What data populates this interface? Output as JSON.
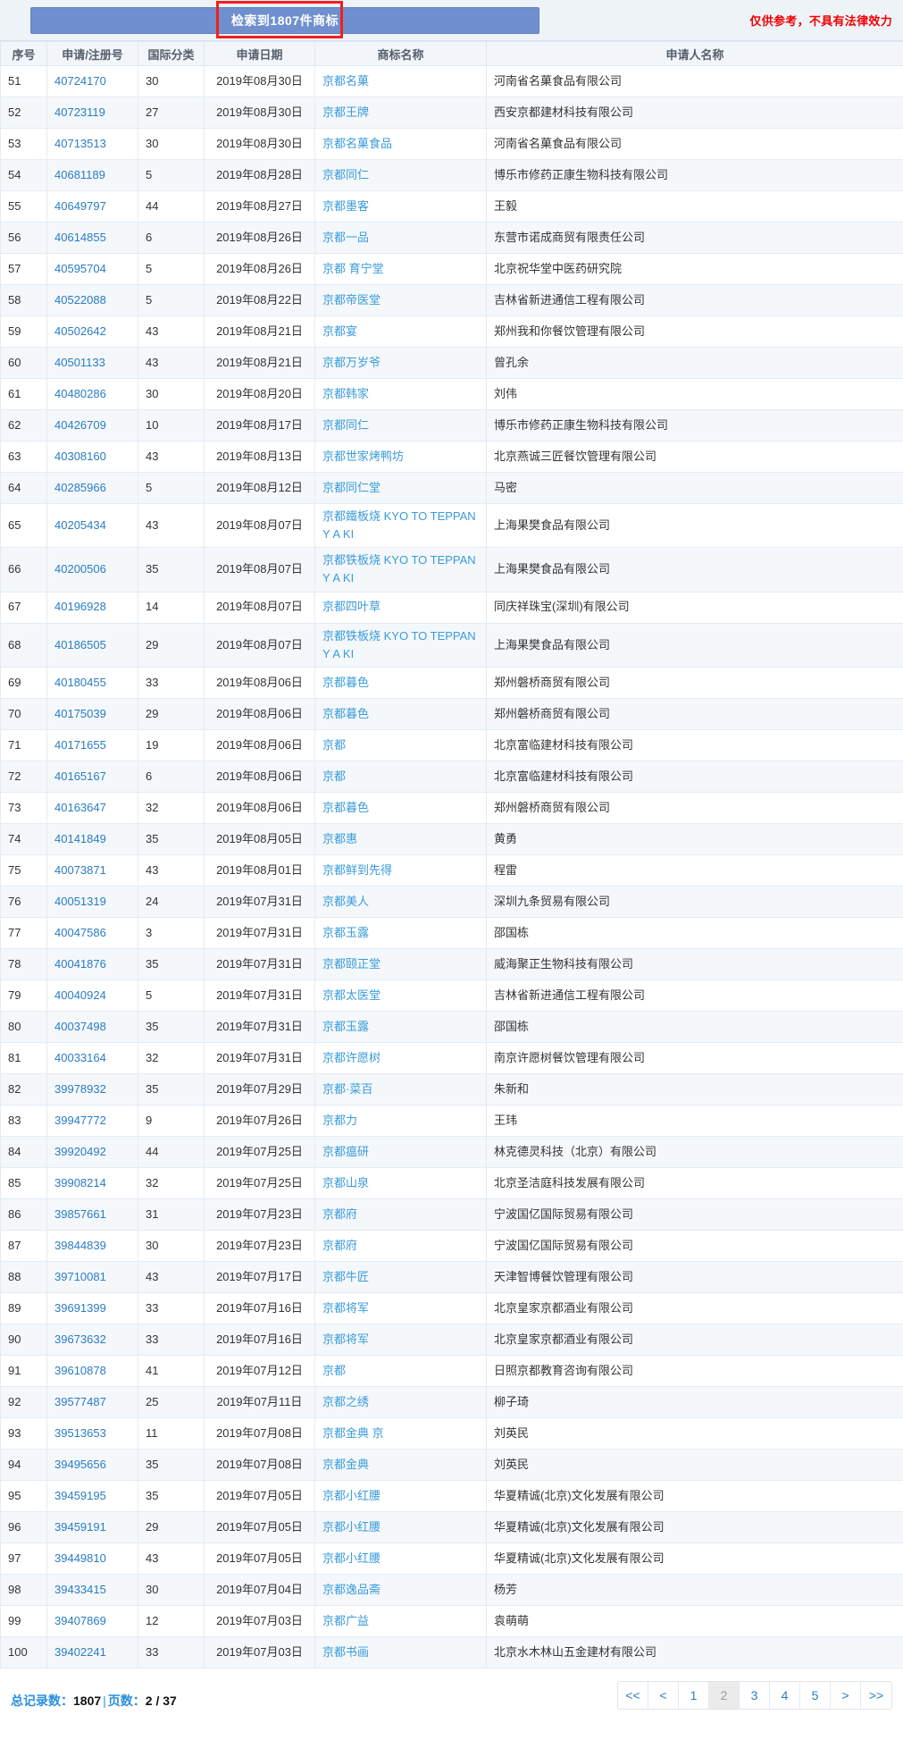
{
  "banner": {
    "result_text": "检索到1807件商标",
    "legal_note": "仅供参考，不具有法律效力",
    "accent_color": "#6f8fce",
    "highlight_color": "#f21f1f",
    "note_color": "#f00000"
  },
  "table": {
    "columns": [
      "序号",
      "申请/注册号",
      "国际分类",
      "申请日期",
      "商标名称",
      "申请人名称"
    ],
    "rows": [
      {
        "seq": "51",
        "regno": "40724170",
        "cls": "30",
        "date": "2019年08月30日",
        "mark": "京都名菓",
        "appl": "河南省名菓食品有限公司"
      },
      {
        "seq": "52",
        "regno": "40723119",
        "cls": "27",
        "date": "2019年08月30日",
        "mark": "京都王牌",
        "appl": "西安京都建材科技有限公司"
      },
      {
        "seq": "53",
        "regno": "40713513",
        "cls": "30",
        "date": "2019年08月30日",
        "mark": "京都名菓食品",
        "appl": "河南省名菓食品有限公司"
      },
      {
        "seq": "54",
        "regno": "40681189",
        "cls": "5",
        "date": "2019年08月28日",
        "mark": "京都同仁",
        "appl": "博乐市修药正康生物科技有限公司"
      },
      {
        "seq": "55",
        "regno": "40649797",
        "cls": "44",
        "date": "2019年08月27日",
        "mark": "京都墨客",
        "appl": "王毅"
      },
      {
        "seq": "56",
        "regno": "40614855",
        "cls": "6",
        "date": "2019年08月26日",
        "mark": "京都一品",
        "appl": "东营市诺成商贸有限责任公司"
      },
      {
        "seq": "57",
        "regno": "40595704",
        "cls": "5",
        "date": "2019年08月26日",
        "mark": "京都 育宁堂",
        "appl": "北京祝华堂中医药研究院"
      },
      {
        "seq": "58",
        "regno": "40522088",
        "cls": "5",
        "date": "2019年08月22日",
        "mark": "京都帝医堂",
        "appl": "吉林省新进通信工程有限公司"
      },
      {
        "seq": "59",
        "regno": "40502642",
        "cls": "43",
        "date": "2019年08月21日",
        "mark": "京都宴",
        "appl": "郑州我和你餐饮管理有限公司"
      },
      {
        "seq": "60",
        "regno": "40501133",
        "cls": "43",
        "date": "2019年08月21日",
        "mark": "京都万岁爷",
        "appl": "曾孔余"
      },
      {
        "seq": "61",
        "regno": "40480286",
        "cls": "30",
        "date": "2019年08月20日",
        "mark": "京都韩家",
        "appl": "刘伟"
      },
      {
        "seq": "62",
        "regno": "40426709",
        "cls": "10",
        "date": "2019年08月17日",
        "mark": "京都同仁",
        "appl": "博乐市修药正康生物科技有限公司"
      },
      {
        "seq": "63",
        "regno": "40308160",
        "cls": "43",
        "date": "2019年08月13日",
        "mark": "京都世家烤鸭坊",
        "appl": "北京燕诚三匠餐饮管理有限公司"
      },
      {
        "seq": "64",
        "regno": "40285966",
        "cls": "5",
        "date": "2019年08月12日",
        "mark": "京都同仁堂",
        "appl": "马密"
      },
      {
        "seq": "65",
        "regno": "40205434",
        "cls": "43",
        "date": "2019年08月07日",
        "mark": "京都鐵板烧 KYO TO TEPPAN Y A KI",
        "appl": "上海果樊食品有限公司"
      },
      {
        "seq": "66",
        "regno": "40200506",
        "cls": "35",
        "date": "2019年08月07日",
        "mark": "京都铁板烧 KYO TO TEPPAN Y A KI",
        "appl": "上海果樊食品有限公司"
      },
      {
        "seq": "67",
        "regno": "40196928",
        "cls": "14",
        "date": "2019年08月07日",
        "mark": "京都四叶草",
        "appl": "同庆祥珠宝(深圳)有限公司"
      },
      {
        "seq": "68",
        "regno": "40186505",
        "cls": "29",
        "date": "2019年08月07日",
        "mark": "京都铁板烧 KYO TO TEPPAN Y A KI",
        "appl": "上海果樊食品有限公司"
      },
      {
        "seq": "69",
        "regno": "40180455",
        "cls": "33",
        "date": "2019年08月06日",
        "mark": "京都暮色",
        "appl": "郑州磐桥商贸有限公司"
      },
      {
        "seq": "70",
        "regno": "40175039",
        "cls": "29",
        "date": "2019年08月06日",
        "mark": "京都暮色",
        "appl": "郑州磐桥商贸有限公司"
      },
      {
        "seq": "71",
        "regno": "40171655",
        "cls": "19",
        "date": "2019年08月06日",
        "mark": "京都",
        "appl": "北京富临建材科技有限公司"
      },
      {
        "seq": "72",
        "regno": "40165167",
        "cls": "6",
        "date": "2019年08月06日",
        "mark": "京都",
        "appl": "北京富临建材科技有限公司"
      },
      {
        "seq": "73",
        "regno": "40163647",
        "cls": "32",
        "date": "2019年08月06日",
        "mark": "京都暮色",
        "appl": "郑州磐桥商贸有限公司"
      },
      {
        "seq": "74",
        "regno": "40141849",
        "cls": "35",
        "date": "2019年08月05日",
        "mark": "京都惠",
        "appl": "黄勇"
      },
      {
        "seq": "75",
        "regno": "40073871",
        "cls": "43",
        "date": "2019年08月01日",
        "mark": "京都鲜到先得",
        "appl": "程雷"
      },
      {
        "seq": "76",
        "regno": "40051319",
        "cls": "24",
        "date": "2019年07月31日",
        "mark": "京都美人",
        "appl": "深圳九条贸易有限公司"
      },
      {
        "seq": "77",
        "regno": "40047586",
        "cls": "3",
        "date": "2019年07月31日",
        "mark": "京都玉露",
        "appl": "邵国栋"
      },
      {
        "seq": "78",
        "regno": "40041876",
        "cls": "35",
        "date": "2019年07月31日",
        "mark": "京都颐正堂",
        "appl": "威海聚正生物科技有限公司"
      },
      {
        "seq": "79",
        "regno": "40040924",
        "cls": "5",
        "date": "2019年07月31日",
        "mark": "京都太医堂",
        "appl": "吉林省新进通信工程有限公司"
      },
      {
        "seq": "80",
        "regno": "40037498",
        "cls": "35",
        "date": "2019年07月31日",
        "mark": "京都玉露",
        "appl": "邵国栋"
      },
      {
        "seq": "81",
        "regno": "40033164",
        "cls": "32",
        "date": "2019年07月31日",
        "mark": "京都许愿树",
        "appl": "南京许愿树餐饮管理有限公司"
      },
      {
        "seq": "82",
        "regno": "39978932",
        "cls": "35",
        "date": "2019年07月29日",
        "mark": "京都·菜百",
        "appl": "朱新和"
      },
      {
        "seq": "83",
        "regno": "39947772",
        "cls": "9",
        "date": "2019年07月26日",
        "mark": "京都力",
        "appl": "王玮"
      },
      {
        "seq": "84",
        "regno": "39920492",
        "cls": "44",
        "date": "2019年07月25日",
        "mark": "京都瘟研",
        "appl": "林克德灵科技（北京）有限公司"
      },
      {
        "seq": "85",
        "regno": "39908214",
        "cls": "32",
        "date": "2019年07月25日",
        "mark": "京都山泉",
        "appl": "北京圣洁庭科技发展有限公司"
      },
      {
        "seq": "86",
        "regno": "39857661",
        "cls": "31",
        "date": "2019年07月23日",
        "mark": "京都府",
        "appl": "宁波国亿国际贸易有限公司"
      },
      {
        "seq": "87",
        "regno": "39844839",
        "cls": "30",
        "date": "2019年07月23日",
        "mark": "京都府",
        "appl": "宁波国亿国际贸易有限公司"
      },
      {
        "seq": "88",
        "regno": "39710081",
        "cls": "43",
        "date": "2019年07月17日",
        "mark": "京都牛匠",
        "appl": "天津智博餐饮管理有限公司"
      },
      {
        "seq": "89",
        "regno": "39691399",
        "cls": "33",
        "date": "2019年07月16日",
        "mark": "京都将军",
        "appl": "北京皇家京都酒业有限公司"
      },
      {
        "seq": "90",
        "regno": "39673632",
        "cls": "33",
        "date": "2019年07月16日",
        "mark": "京都将军",
        "appl": "北京皇家京都酒业有限公司"
      },
      {
        "seq": "91",
        "regno": "39610878",
        "cls": "41",
        "date": "2019年07月12日",
        "mark": "京都",
        "appl": "日照京都教育咨询有限公司"
      },
      {
        "seq": "92",
        "regno": "39577487",
        "cls": "25",
        "date": "2019年07月11日",
        "mark": "京都之绣",
        "appl": "柳子琦"
      },
      {
        "seq": "93",
        "regno": "39513653",
        "cls": "11",
        "date": "2019年07月08日",
        "mark": "京都金典 京",
        "appl": "刘英民"
      },
      {
        "seq": "94",
        "regno": "39495656",
        "cls": "35",
        "date": "2019年07月08日",
        "mark": "京都金典",
        "appl": "刘英民"
      },
      {
        "seq": "95",
        "regno": "39459195",
        "cls": "35",
        "date": "2019年07月05日",
        "mark": "京都小红腰",
        "appl": "华夏精诚(北京)文化发展有限公司"
      },
      {
        "seq": "96",
        "regno": "39459191",
        "cls": "29",
        "date": "2019年07月05日",
        "mark": "京都小红腰",
        "appl": "华夏精诚(北京)文化发展有限公司"
      },
      {
        "seq": "97",
        "regno": "39449810",
        "cls": "43",
        "date": "2019年07月05日",
        "mark": "京都小红腰",
        "appl": "华夏精诚(北京)文化发展有限公司"
      },
      {
        "seq": "98",
        "regno": "39433415",
        "cls": "30",
        "date": "2019年07月04日",
        "mark": "京都逸品斋",
        "appl": "杨芳"
      },
      {
        "seq": "99",
        "regno": "39407869",
        "cls": "12",
        "date": "2019年07月03日",
        "mark": "京都广益",
        "appl": "袁萌萌"
      },
      {
        "seq": "100",
        "regno": "39402241",
        "cls": "33",
        "date": "2019年07月03日",
        "mark": "京都书画",
        "appl": "北京水木林山五金建材有限公司"
      }
    ]
  },
  "footer": {
    "total_label": "总记录数：",
    "total_value": "1807",
    "separator": "|",
    "page_label": "页数：",
    "page_value": "2 / 37",
    "pagination": [
      {
        "label": "<<",
        "name": "first-page",
        "active": false
      },
      {
        "label": "<",
        "name": "prev-page",
        "active": false
      },
      {
        "label": "1",
        "name": "page-1",
        "active": false
      },
      {
        "label": "2",
        "name": "page-2",
        "active": true
      },
      {
        "label": "3",
        "name": "page-3",
        "active": false
      },
      {
        "label": "4",
        "name": "page-4",
        "active": false
      },
      {
        "label": "5",
        "name": "page-5",
        "active": false
      },
      {
        "label": ">",
        "name": "next-page",
        "active": false
      },
      {
        "label": ">>",
        "name": "last-page",
        "active": false
      }
    ]
  }
}
